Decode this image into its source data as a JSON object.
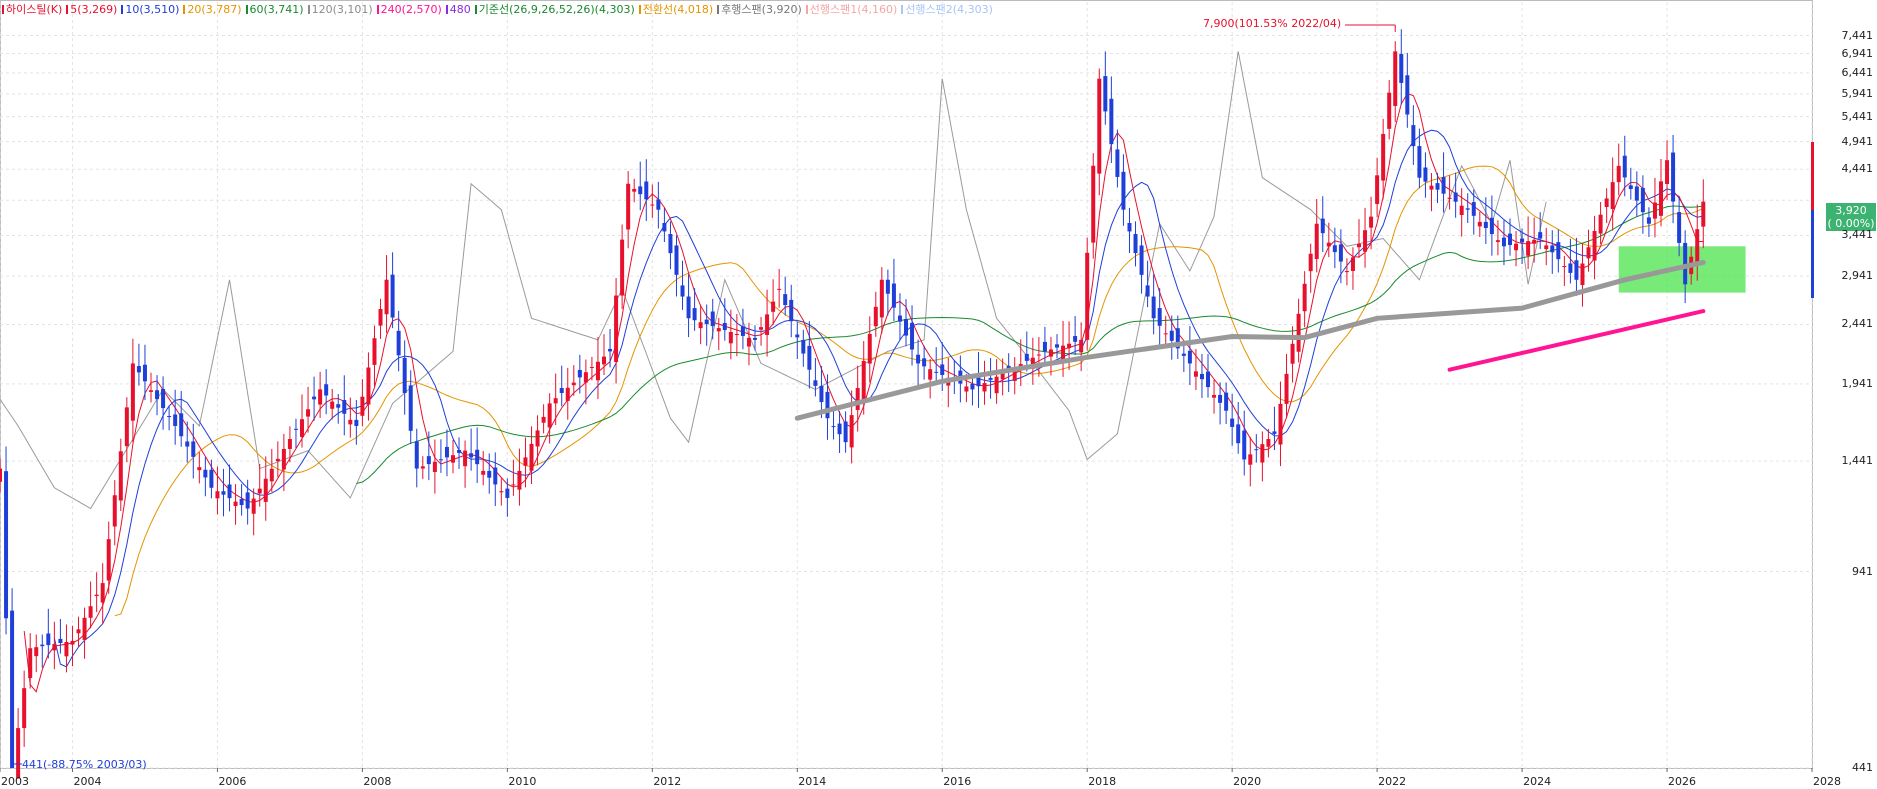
{
  "legend": [
    {
      "label": "하이스틸(K)",
      "color": "#e8112d"
    },
    {
      "label": "5(3,269)",
      "color": "#e8112d"
    },
    {
      "label": "10(3,510)",
      "color": "#1f3fd9"
    },
    {
      "label": "20(3,787)",
      "color": "#e59400"
    },
    {
      "label": "60(3,741)",
      "color": "#1a8a2e"
    },
    {
      "label": "120(3,101)",
      "color": "#8c8c8c"
    },
    {
      "label": "240(2,570)",
      "color": "#ff1493"
    },
    {
      "label": "480",
      "color": "#8a2be2"
    },
    {
      "label": "기준선(26,9,26,52,26)(4,303)",
      "color": "#1a8a2e"
    },
    {
      "label": "전환선(4,018)",
      "color": "#e59400"
    },
    {
      "label": "후행스팬(3,920)",
      "color": "#777777"
    },
    {
      "label": "선행스팬1(4,160)",
      "color": "#f4a6a6"
    },
    {
      "label": "선행스팬2(4,303)",
      "color": "#a9c4f5"
    }
  ],
  "price_tag": {
    "value": "3,920",
    "change": "( 0.00%)"
  },
  "annotations": {
    "high": "7,900(101.53% 2022/04)",
    "low": "441(-88.75% 2003/03)"
  },
  "chart_data": {
    "type": "candlestick",
    "yscale": "log",
    "ylim": [
      441,
      7900
    ],
    "xlim": [
      "2003",
      "2028"
    ],
    "y_ticks": [
      441,
      941,
      1441,
      1941,
      2441,
      2941,
      3441,
      3941,
      4441,
      4941,
      5441,
      5941,
      6441,
      6941,
      7441
    ],
    "y_tick_labels": [
      "441",
      "941",
      "1,441",
      "1,941",
      "2,441",
      "2,941",
      "3,441",
      "",
      "4,441",
      "4,941",
      "5,441",
      "5,941",
      "6,441",
      "6,941",
      "7,441"
    ],
    "x_ticks": [
      "2003",
      "2004",
      "2006",
      "2008",
      "2010",
      "2012",
      "2014",
      "2016",
      "2018",
      "2020",
      "2022",
      "2024",
      "2026",
      "2028"
    ],
    "grid": true,
    "colors": {
      "up": "#e8112d",
      "down": "#1f3fd9"
    },
    "anchor_points": [
      {
        "t": "2003-01",
        "close": 1400
      },
      {
        "t": "2003-03",
        "close": 441
      },
      {
        "t": "2003-06",
        "close": 700
      },
      {
        "t": "2004-01",
        "close": 720
      },
      {
        "t": "2004-06",
        "close": 900
      },
      {
        "t": "2004-11",
        "close": 2100
      },
      {
        "t": "2005-06",
        "close": 1650
      },
      {
        "t": "2005-12",
        "close": 1300
      },
      {
        "t": "2006-06",
        "close": 1200
      },
      {
        "t": "2007-06",
        "close": 1900
      },
      {
        "t": "2007-12",
        "close": 1650
      },
      {
        "t": "2008-05",
        "close": 2900
      },
      {
        "t": "2008-10",
        "close": 1400
      },
      {
        "t": "2009-06",
        "close": 1500
      },
      {
        "t": "2010-01",
        "close": 1250
      },
      {
        "t": "2010-08",
        "close": 1800
      },
      {
        "t": "2011-06",
        "close": 2200
      },
      {
        "t": "2011-09",
        "close": 4200
      },
      {
        "t": "2012-02",
        "close": 3800
      },
      {
        "t": "2012-07",
        "close": 2500
      },
      {
        "t": "2013-06",
        "close": 2300
      },
      {
        "t": "2013-10",
        "close": 2800
      },
      {
        "t": "2014-06",
        "close": 1700
      },
      {
        "t": "2014-09",
        "close": 1550
      },
      {
        "t": "2015-03",
        "close": 2900
      },
      {
        "t": "2015-09",
        "close": 2100
      },
      {
        "t": "2016-06",
        "close": 1900
      },
      {
        "t": "2017-06",
        "close": 2200
      },
      {
        "t": "2017-12",
        "close": 2300
      },
      {
        "t": "2018-03",
        "close": 6300
      },
      {
        "t": "2018-07",
        "close": 3800
      },
      {
        "t": "2018-12",
        "close": 2500
      },
      {
        "t": "2019-06",
        "close": 2100
      },
      {
        "t": "2019-12",
        "close": 1750
      },
      {
        "t": "2020-03",
        "close": 1450
      },
      {
        "t": "2020-08",
        "close": 1600
      },
      {
        "t": "2021-03",
        "close": 3600
      },
      {
        "t": "2021-08",
        "close": 3000
      },
      {
        "t": "2021-12",
        "close": 3700
      },
      {
        "t": "2022-04",
        "close": 7000
      },
      {
        "t": "2022-08",
        "close": 4300
      },
      {
        "t": "2023-04",
        "close": 3800
      },
      {
        "t": "2023-10",
        "close": 3300
      },
      {
        "t": "2024-04",
        "close": 3400
      },
      {
        "t": "2024-10",
        "close": 2900
      },
      {
        "t": "2025-05",
        "close": 4500
      },
      {
        "t": "2025-10",
        "close": 3600
      },
      {
        "t": "2026-01",
        "close": 4600
      },
      {
        "t": "2026-04",
        "close": 2850
      },
      {
        "t": "2026-07",
        "close": 3920
      }
    ],
    "ma120": [
      {
        "t": "2014-01",
        "v": 1700
      },
      {
        "t": "2016-01",
        "v": 1960
      },
      {
        "t": "2018-01",
        "v": 2150
      },
      {
        "t": "2020-01",
        "v": 2330
      },
      {
        "t": "2021-01",
        "v": 2320
      },
      {
        "t": "2022-01",
        "v": 2500
      },
      {
        "t": "2024-01",
        "v": 2600
      },
      {
        "t": "2025-06",
        "v": 2900
      },
      {
        "t": "2026-07",
        "v": 3101
      }
    ],
    "ma240": [
      {
        "t": "2023-01",
        "v": 2050
      },
      {
        "t": "2026-07",
        "v": 2570
      }
    ],
    "box": {
      "t0": "2025-05",
      "t1": "2027-02",
      "v0": 2760,
      "v1": 3300
    }
  }
}
